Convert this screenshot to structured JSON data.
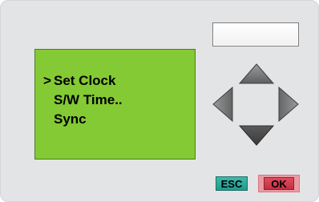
{
  "lcd": {
    "cursor": ">",
    "items": [
      {
        "label": "Set Clock",
        "selected": true
      },
      {
        "label": "S/W Time..",
        "selected": false
      },
      {
        "label": "Sync",
        "selected": false
      }
    ],
    "background_color": "#84ca34"
  },
  "keypad": {
    "top_button_label": "",
    "arrows": [
      "up-arrow-icon",
      "left-arrow-icon",
      "right-arrow-icon",
      "down-arrow-icon"
    ],
    "esc_label": "ESC",
    "ok_label": "OK",
    "esc_color": "#2aa596",
    "ok_color": "#d23b4d"
  }
}
